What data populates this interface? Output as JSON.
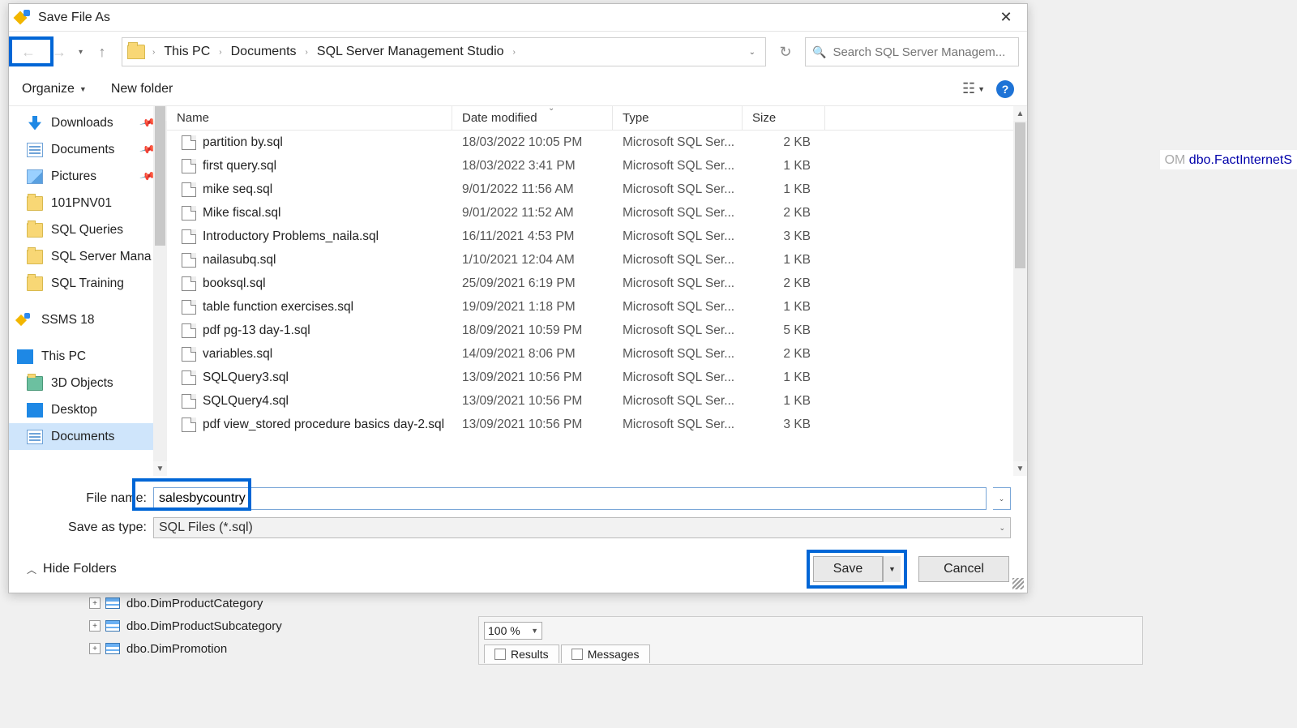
{
  "dialog": {
    "title": "Save File As",
    "breadcrumb": {
      "pc": "This PC",
      "docs": "Documents",
      "ssms": "SQL Server Management Studio"
    },
    "search_placeholder": "Search SQL Server Managem...",
    "toolbar": {
      "organize": "Organize",
      "new_folder": "New folder"
    },
    "nav": {
      "items": [
        {
          "label": "Downloads",
          "pinned": true,
          "icon": "dl"
        },
        {
          "label": "Documents",
          "pinned": true,
          "icon": "doc"
        },
        {
          "label": "Pictures",
          "pinned": true,
          "icon": "pic"
        },
        {
          "label": "101PNV01",
          "icon": "folder"
        },
        {
          "label": "SQL Queries",
          "icon": "folder"
        },
        {
          "label": "SQL Server Mana",
          "icon": "folder"
        },
        {
          "label": "SQL Training",
          "icon": "folder"
        }
      ],
      "ssms": "SSMS 18",
      "thispc": "This PC",
      "pc_children": [
        {
          "label": "3D Objects",
          "icon": "folder3d"
        },
        {
          "label": "Desktop",
          "icon": "desktop"
        },
        {
          "label": "Documents",
          "icon": "doc",
          "selected": true
        }
      ]
    },
    "columns": {
      "name": "Name",
      "date": "Date modified",
      "type": "Type",
      "size": "Size"
    },
    "files": [
      {
        "name": "partition by.sql",
        "date": "18/03/2022 10:05 PM",
        "type": "Microsoft SQL Ser...",
        "size": "2 KB"
      },
      {
        "name": "first query.sql",
        "date": "18/03/2022 3:41 PM",
        "type": "Microsoft SQL Ser...",
        "size": "1 KB"
      },
      {
        "name": "mike seq.sql",
        "date": "9/01/2022 11:56 AM",
        "type": "Microsoft SQL Ser...",
        "size": "1 KB"
      },
      {
        "name": "Mike fiscal.sql",
        "date": "9/01/2022 11:52 AM",
        "type": "Microsoft SQL Ser...",
        "size": "2 KB"
      },
      {
        "name": "Introductory Problems_naila.sql",
        "date": "16/11/2021 4:53 PM",
        "type": "Microsoft SQL Ser...",
        "size": "3 KB"
      },
      {
        "name": "nailasubq.sql",
        "date": "1/10/2021 12:04 AM",
        "type": "Microsoft SQL Ser...",
        "size": "1 KB"
      },
      {
        "name": "booksql.sql",
        "date": "25/09/2021 6:19 PM",
        "type": "Microsoft SQL Ser...",
        "size": "2 KB"
      },
      {
        "name": "table function exercises.sql",
        "date": "19/09/2021 1:18 PM",
        "type": "Microsoft SQL Ser...",
        "size": "1 KB"
      },
      {
        "name": "pdf pg-13 day-1.sql",
        "date": "18/09/2021 10:59 PM",
        "type": "Microsoft SQL Ser...",
        "size": "5 KB"
      },
      {
        "name": "variables.sql",
        "date": "14/09/2021 8:06 PM",
        "type": "Microsoft SQL Ser...",
        "size": "2 KB"
      },
      {
        "name": "SQLQuery3.sql",
        "date": "13/09/2021 10:56 PM",
        "type": "Microsoft SQL Ser...",
        "size": "1 KB"
      },
      {
        "name": "SQLQuery4.sql",
        "date": "13/09/2021 10:56 PM",
        "type": "Microsoft SQL Ser...",
        "size": "1 KB"
      },
      {
        "name": "pdf view_stored procedure basics day-2.sql",
        "date": "13/09/2021 10:56 PM",
        "type": "Microsoft SQL Ser...",
        "size": "3 KB"
      }
    ],
    "filename_label": "File name:",
    "filename_value": "salesbycountry",
    "type_label": "Save as type:",
    "type_value": "SQL Files (*.sql)",
    "hide_folders": "Hide Folders",
    "save": "Save",
    "cancel": "Cancel"
  },
  "editor": {
    "kw_om": "OM",
    "table_ref": " dbo.FactInternetS"
  },
  "zoombar": {
    "zoom": "100 %",
    "results_tab": "Results",
    "messages_tab": "Messages"
  },
  "tree_bg": {
    "items": [
      {
        "label": "dbo.DimProductCategory"
      },
      {
        "label": "dbo.DimProductSubcategory"
      },
      {
        "label": "dbo.DimPromotion"
      }
    ]
  }
}
